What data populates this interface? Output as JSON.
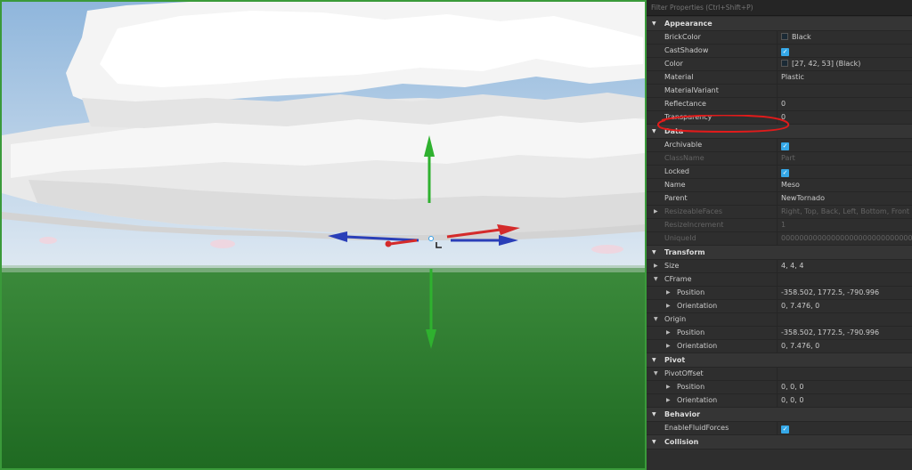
{
  "search": {
    "placeholder": "Filter Properties (Ctrl+Shift+P)"
  },
  "viewport": {
    "name": "3D viewport",
    "colors": {
      "border": "#3a9a3a",
      "sky": "#aacaea",
      "ground": "#2f7f30",
      "cloud": "#f2f2f2"
    }
  },
  "sections": [
    {
      "title": "Appearance",
      "rows": [
        {
          "name": "BrickColor",
          "value": "Black",
          "swatch": "#1b2a35"
        },
        {
          "name": "CastShadow",
          "checkbox": true
        },
        {
          "name": "Color",
          "value": "[27, 42, 53] (Black)",
          "swatch": "#1b2a35"
        },
        {
          "name": "Material",
          "value": "Plastic"
        },
        {
          "name": "MaterialVariant",
          "value": ""
        },
        {
          "name": "Reflectance",
          "value": "0"
        },
        {
          "name": "Transparency",
          "value": "0"
        }
      ]
    },
    {
      "title": "Data",
      "rows": [
        {
          "name": "Archivable",
          "checkbox": true
        },
        {
          "name": "ClassName",
          "value": "Part",
          "dim": true
        },
        {
          "name": "Locked",
          "checkbox": true
        },
        {
          "name": "Name",
          "value": "Meso"
        },
        {
          "name": "Parent",
          "value": "NewTornado"
        },
        {
          "name": "ResizeableFaces",
          "value": "Right, Top, Back, Left, Bottom, Front",
          "dim": true,
          "expand": true
        },
        {
          "name": "ResizeIncrement",
          "value": "1",
          "dim": true
        },
        {
          "name": "UniqueId",
          "value": "00000000000000000000000000000000",
          "dim": true
        }
      ]
    },
    {
      "title": "Transform",
      "rows": [
        {
          "name": "Size",
          "value": "4, 4, 4",
          "expand": true
        },
        {
          "name": "CFrame",
          "value": "",
          "expanded": true
        },
        {
          "name": "Position",
          "value": "-358.502, 1772.5, -790.996",
          "sub": true
        },
        {
          "name": "Orientation",
          "value": "0, 7.476, 0",
          "sub": true
        },
        {
          "name": "Origin",
          "value": "",
          "expanded": true
        },
        {
          "name": "Position",
          "value": "-358.502, 1772.5, -790.996",
          "sub": true
        },
        {
          "name": "Orientation",
          "value": "0, 7.476, 0",
          "sub": true
        }
      ]
    },
    {
      "title": "Pivot",
      "rows": [
        {
          "name": "PivotOffset",
          "value": "",
          "expanded": true
        },
        {
          "name": "Position",
          "value": "0, 0, 0",
          "sub": true
        },
        {
          "name": "Orientation",
          "value": "0, 0, 0",
          "sub": true
        }
      ]
    },
    {
      "title": "Behavior",
      "rows": [
        {
          "name": "EnableFluidForces",
          "checkbox": true
        }
      ]
    },
    {
      "title": "Collision",
      "rows": []
    }
  ],
  "annotation": {
    "color": "#e01b1b",
    "target": "Transparency"
  }
}
